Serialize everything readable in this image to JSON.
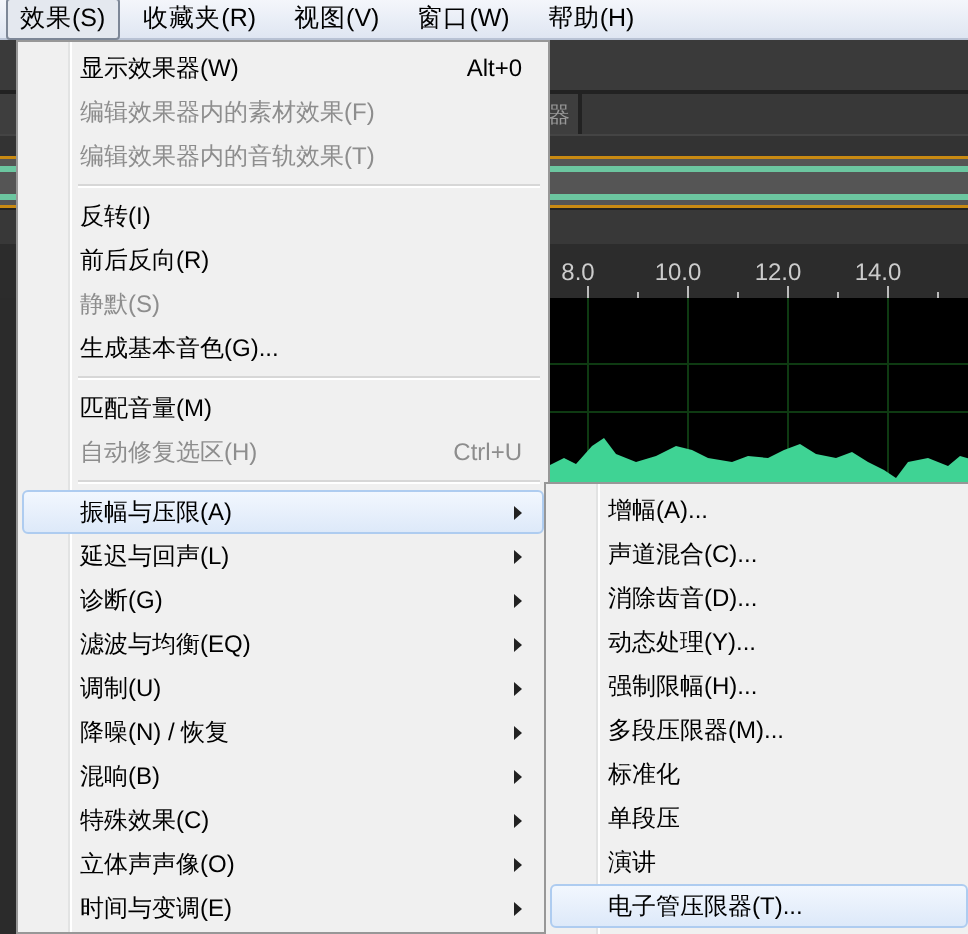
{
  "menubar": [
    {
      "label": "效果(S)",
      "selected": true
    },
    {
      "label": "收藏夹(R)",
      "selected": false
    },
    {
      "label": "视图(V)",
      "selected": false
    },
    {
      "label": "窗口(W)",
      "selected": false
    },
    {
      "label": "帮助(H)",
      "selected": false
    }
  ],
  "background": {
    "tab_label": "器",
    "ruler": [
      "8.0",
      "10.0",
      "12.0",
      "14.0"
    ]
  },
  "menu": [
    {
      "kind": "item",
      "label": "显示效果器(W)",
      "shortcut": "Alt+0",
      "disabled": false,
      "submenu": false,
      "selected": false
    },
    {
      "kind": "item",
      "label": "编辑效果器内的素材效果(F)",
      "disabled": true,
      "submenu": false,
      "selected": false
    },
    {
      "kind": "item",
      "label": "编辑效果器内的音轨效果(T)",
      "disabled": true,
      "submenu": false,
      "selected": false
    },
    {
      "kind": "separator"
    },
    {
      "kind": "item",
      "label": "反转(I)",
      "disabled": false,
      "submenu": false,
      "selected": false
    },
    {
      "kind": "item",
      "label": "前后反向(R)",
      "disabled": false,
      "submenu": false,
      "selected": false
    },
    {
      "kind": "item",
      "label": "静默(S)",
      "disabled": true,
      "submenu": false,
      "selected": false
    },
    {
      "kind": "item",
      "label": "生成基本音色(G)...",
      "disabled": false,
      "submenu": false,
      "selected": false
    },
    {
      "kind": "separator"
    },
    {
      "kind": "item",
      "label": "匹配音量(M)",
      "disabled": false,
      "submenu": false,
      "selected": false
    },
    {
      "kind": "item",
      "label": "自动修复选区(H)",
      "shortcut": "Ctrl+U",
      "disabled": true,
      "submenu": false,
      "selected": false
    },
    {
      "kind": "separator"
    },
    {
      "kind": "item",
      "label": "振幅与压限(A)",
      "disabled": false,
      "submenu": true,
      "selected": true
    },
    {
      "kind": "item",
      "label": "延迟与回声(L)",
      "disabled": false,
      "submenu": true,
      "selected": false
    },
    {
      "kind": "item",
      "label": "诊断(G)",
      "disabled": false,
      "submenu": true,
      "selected": false
    },
    {
      "kind": "item",
      "label": "滤波与均衡(EQ)",
      "disabled": false,
      "submenu": true,
      "selected": false
    },
    {
      "kind": "item",
      "label": "调制(U)",
      "disabled": false,
      "submenu": true,
      "selected": false
    },
    {
      "kind": "item",
      "label": "降噪(N) / 恢复",
      "disabled": false,
      "submenu": true,
      "selected": false
    },
    {
      "kind": "item",
      "label": "混响(B)",
      "disabled": false,
      "submenu": true,
      "selected": false
    },
    {
      "kind": "item",
      "label": "特殊效果(C)",
      "disabled": false,
      "submenu": true,
      "selected": false
    },
    {
      "kind": "item",
      "label": "立体声声像(O)",
      "disabled": false,
      "submenu": true,
      "selected": false
    },
    {
      "kind": "item",
      "label": "时间与变调(E)",
      "disabled": false,
      "submenu": true,
      "selected": false
    }
  ],
  "submenu": [
    {
      "kind": "item",
      "label": "增幅(A)...",
      "selected": false
    },
    {
      "kind": "item",
      "label": "声道混合(C)...",
      "selected": false
    },
    {
      "kind": "item",
      "label": "消除齿音(D)...",
      "selected": false
    },
    {
      "kind": "item",
      "label": "动态处理(Y)...",
      "selected": false
    },
    {
      "kind": "item",
      "label": "强制限幅(H)...",
      "selected": false
    },
    {
      "kind": "item",
      "label": "多段压限器(M)...",
      "selected": false
    },
    {
      "kind": "item",
      "label": "标准化",
      "selected": false
    },
    {
      "kind": "item",
      "label": "单段压",
      "selected": false
    },
    {
      "kind": "item",
      "label": "演讲",
      "selected": false
    },
    {
      "kind": "item",
      "label": "电子管压限器(T)...",
      "selected": true
    }
  ]
}
